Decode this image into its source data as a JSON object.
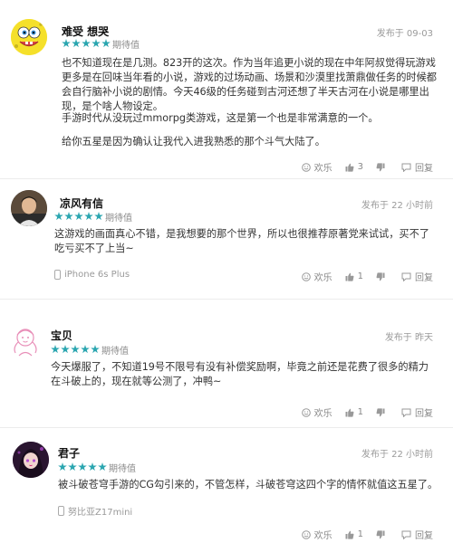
{
  "reviews": [
    {
      "username": "难受 想哭",
      "rating_label": "期待值",
      "stars": 5,
      "time": "发布于 09-03",
      "paragraphs": [
        "也不知道现在是几测。823开的这次。作为当年追更小说的现在中年阿叔觉得玩游戏更多是在回味当年看的小说，游戏的过场动画、场景和沙漠里找萧鼎做任务的时候都会自行脑补小说的剧情。今天46级的任务碰到古河还想了半天古河在小说是哪里出现，是个啥人物设定。",
        "手游时代从没玩过mmorpg类游戏，这是第一个也是非常满意的一个。",
        "给你五星是因为确认让我代入进我熟悉的那个斗气大陆了。"
      ],
      "device": "",
      "actions": {
        "happy_label": "欢乐",
        "like_count": "3",
        "dislike_count": "",
        "reply_label": "回复"
      }
    },
    {
      "username": "凉风有信",
      "rating_label": "期待值",
      "stars": 5,
      "time": "发布于 22 小时前",
      "paragraphs": [
        "这游戏的画面真心不错，是我想要的那个世界，所以也很推荐原著党来试试，买不了吃亏买不了上当~"
      ],
      "device": "iPhone 6s Plus",
      "actions": {
        "happy_label": "欢乐",
        "like_count": "1",
        "dislike_count": "",
        "reply_label": "回复"
      }
    },
    {
      "username": "宝贝",
      "rating_label": "期待值",
      "stars": 5,
      "time": "发布于 昨天",
      "paragraphs": [
        "今天爆服了，不知道19号不限号有没有补偿奖励啊，毕竟之前还是花费了很多的精力在斗破上的，现在就等公测了，冲鸭~"
      ],
      "device": "",
      "actions": {
        "happy_label": "欢乐",
        "like_count": "1",
        "dislike_count": "",
        "reply_label": "回复"
      }
    },
    {
      "username": "君子",
      "rating_label": "期待值",
      "stars": 5,
      "time": "发布于 22 小时前",
      "paragraphs": [
        "被斗破苍穹手游的CG勾引来的，不管怎样，斗破苍穹这四个字的情怀就值这五星了。"
      ],
      "device": "努比亚Z17mini",
      "actions": {
        "happy_label": "欢乐",
        "like_count": "1",
        "dislike_count": "",
        "reply_label": "回复"
      }
    }
  ],
  "colors": {
    "star": "#2ba6b0",
    "meta": "#9a9a9a",
    "body": "#333333"
  },
  "icons": [
    "happy-face-icon",
    "thumbs-up-icon",
    "thumbs-down-icon",
    "comment-icon",
    "phone-icon"
  ]
}
